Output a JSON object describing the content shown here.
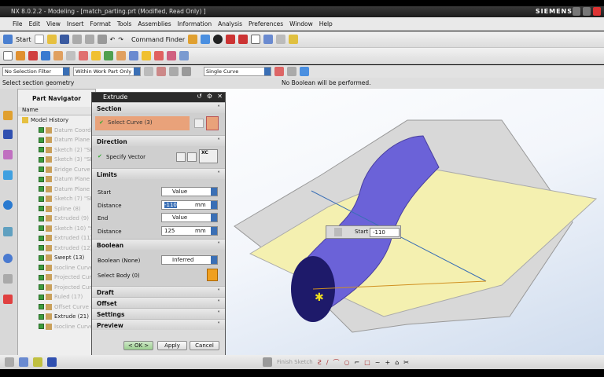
{
  "window": {
    "title": "NX 8.0.2.2 - Modeling - [match_parting.prt (Modified, Read Only) ]",
    "brand": "SIEMENS"
  },
  "menu": [
    "File",
    "Edit",
    "View",
    "Insert",
    "Format",
    "Tools",
    "Assemblies",
    "Information",
    "Analysis",
    "Preferences",
    "Window",
    "Help"
  ],
  "toolbar": {
    "start": "Start",
    "command_finder": "Command Finder"
  },
  "selection_bar": {
    "filter": "No Selection Filter",
    "scope": "Within Work Part Only",
    "curve_rule": "Single Curve"
  },
  "status": {
    "prompt": "Select section geometry",
    "message": "No Boolean will be performed."
  },
  "navigator": {
    "title": "Part Navigator",
    "column": "Name",
    "root": "Model History",
    "items": [
      {
        "label": "Datum Coordinate",
        "active": false
      },
      {
        "label": "Datum Plane (1)",
        "active": false
      },
      {
        "label": "Sketch (2) \"SKE",
        "active": false
      },
      {
        "label": "Sketch (3) \"SKE",
        "active": false
      },
      {
        "label": "Bridge Curve (4)",
        "active": false
      },
      {
        "label": "Datum Plane (5)",
        "active": false
      },
      {
        "label": "Datum Plane (6)",
        "active": false
      },
      {
        "label": "Sketch (7) \"SKE",
        "active": false
      },
      {
        "label": "Spline (8)",
        "active": false
      },
      {
        "label": "Extruded (9)",
        "active": false
      },
      {
        "label": "Sketch (10) \"SK",
        "active": false
      },
      {
        "label": "Extruded (11)",
        "active": false
      },
      {
        "label": "Extruded (12)",
        "active": false
      },
      {
        "label": "Swept (13)",
        "active": true
      },
      {
        "label": "Isocline Curve (",
        "active": false
      },
      {
        "label": "Projected Curve",
        "active": false
      },
      {
        "label": "Projected Curve",
        "active": false
      },
      {
        "label": "Ruled (17)",
        "active": false
      },
      {
        "label": "Offset Curve (2",
        "active": false
      },
      {
        "label": "Extrude (21)",
        "active": true
      },
      {
        "label": "Isocline Curve (",
        "active": false
      }
    ]
  },
  "dialog": {
    "title": "Extrude",
    "section": {
      "header": "Section",
      "select_curve": "Select Curve (3)"
    },
    "direction": {
      "header": "Direction",
      "specify_vector": "Specify Vector",
      "vector": "XC"
    },
    "limits": {
      "header": "Limits",
      "start_label": "Start",
      "start_option": "Value",
      "distance_label": "Distance",
      "start_distance": "-110",
      "unit": "mm",
      "end_label": "End",
      "end_option": "Value",
      "end_distance": "125"
    },
    "boolean": {
      "header": "Boolean",
      "boolean_label": "Boolean (None)",
      "boolean_option": "Inferred",
      "select_body": "Select Body (0)"
    },
    "collapsed": [
      "Draft",
      "Offset",
      "Settings",
      "Preview"
    ],
    "buttons": {
      "ok": "< OK >",
      "apply": "Apply",
      "cancel": "Cancel"
    }
  },
  "viewport": {
    "handle_label": "Start",
    "handle_value": "-110"
  },
  "sketch_bar": {
    "finish": "Finish Sketch"
  },
  "colors": {
    "tube": "#6b62d8",
    "surface": "#f4f0b0",
    "selected": "#e9a27a",
    "accent": "#3a6fb5"
  }
}
